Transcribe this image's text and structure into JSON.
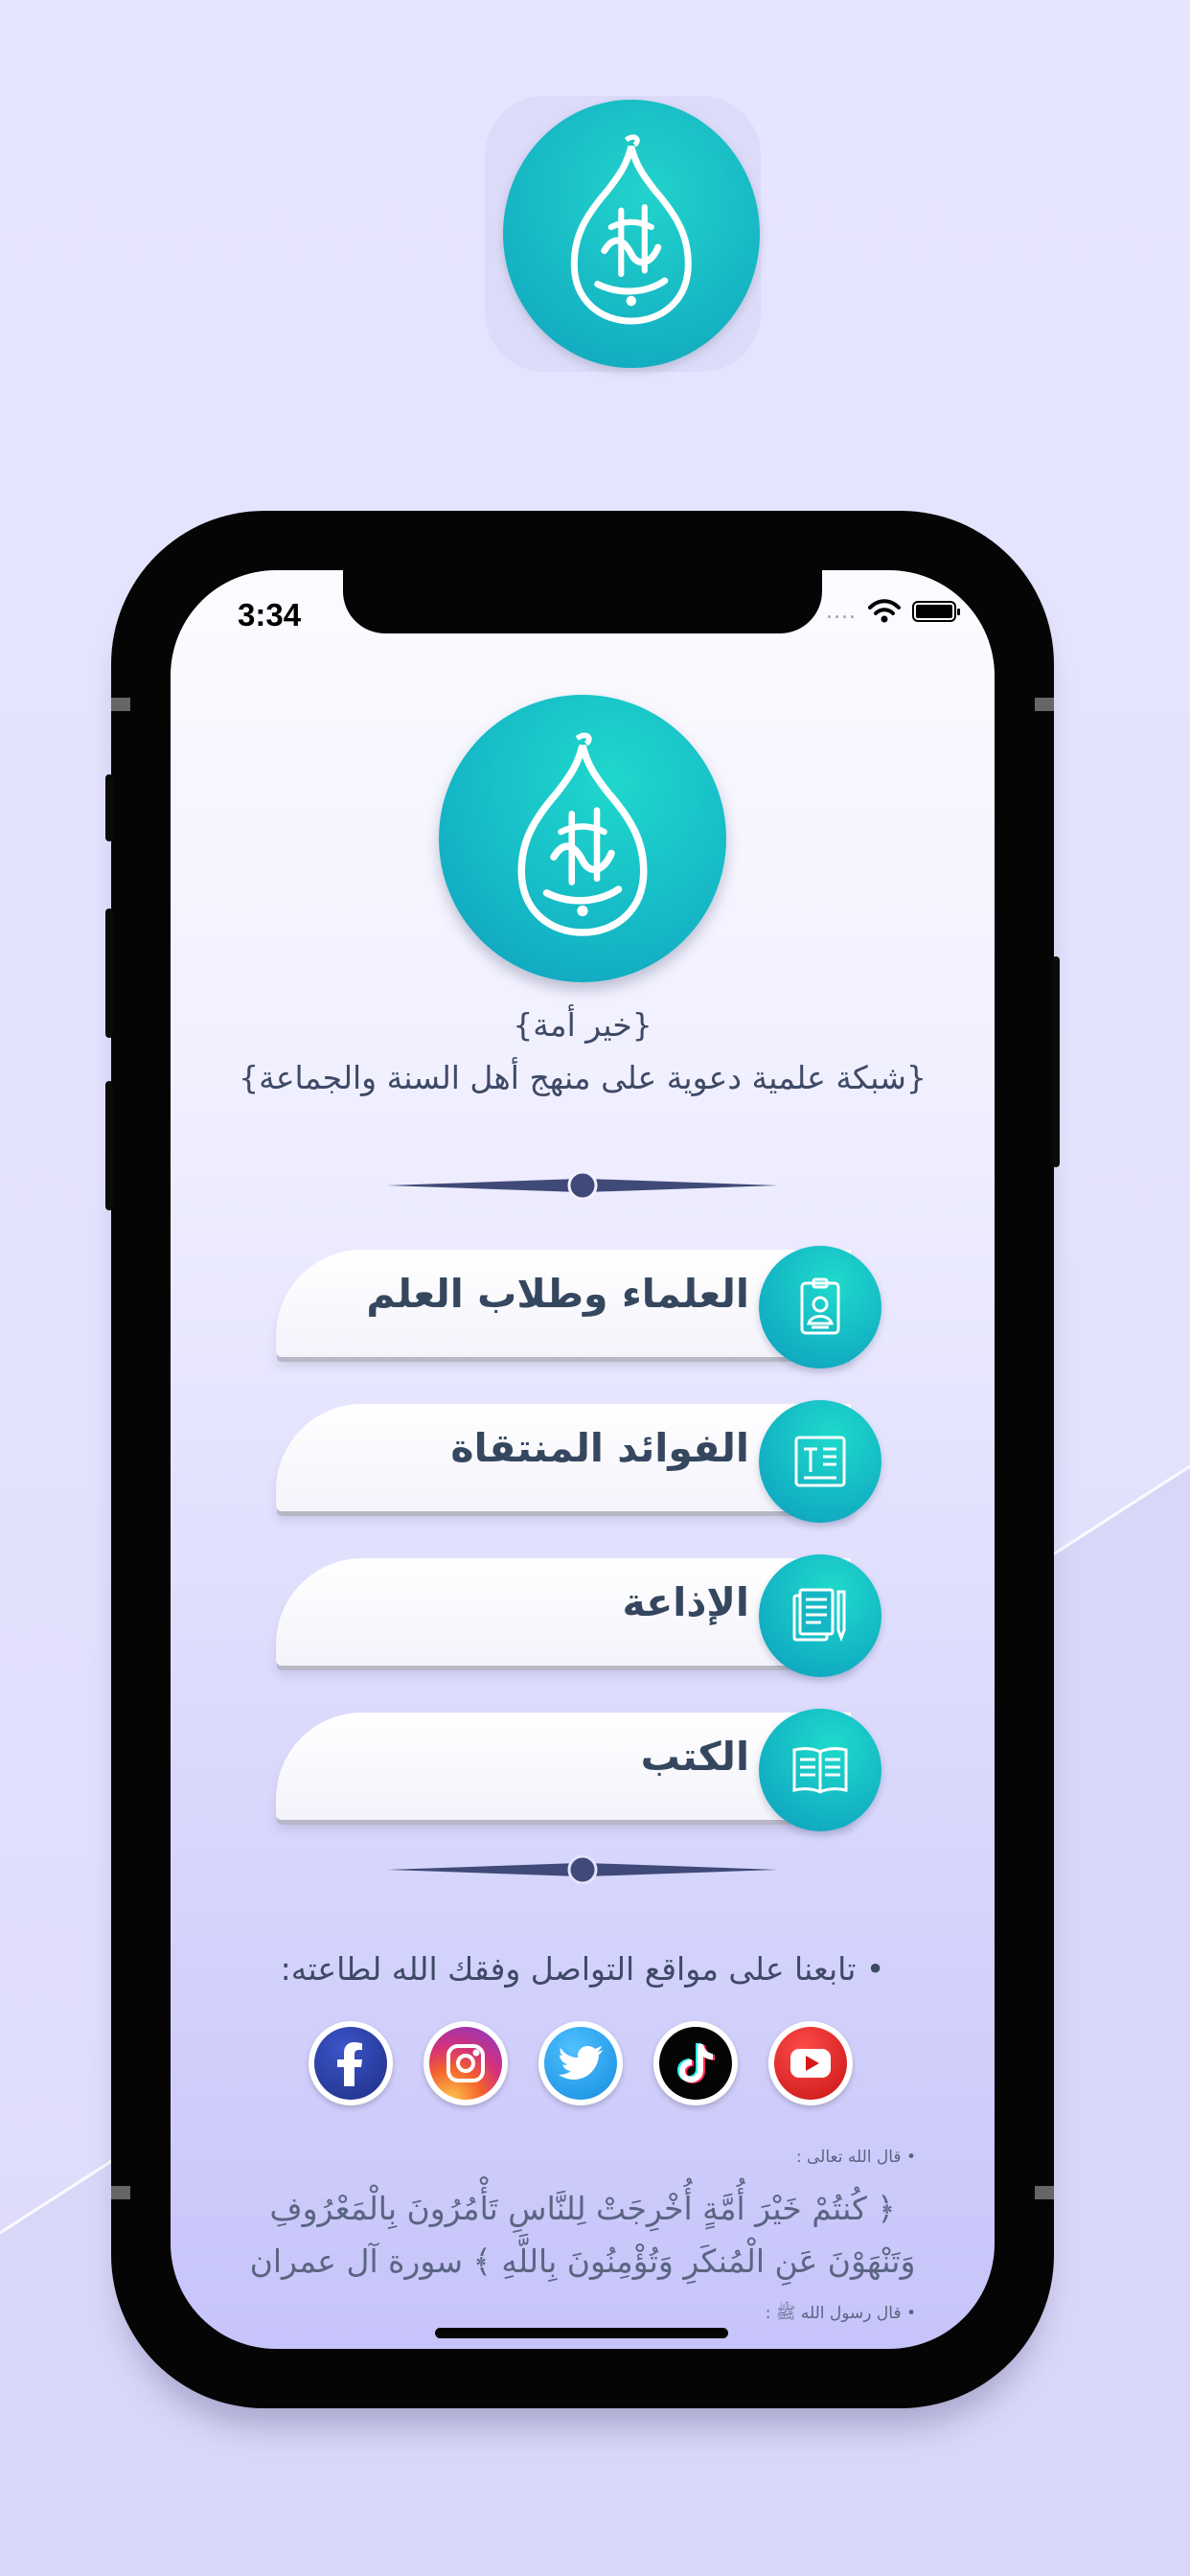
{
  "status_bar": {
    "time": "3:34",
    "signal_dots": "....",
    "wifi_icon": "wifi-icon",
    "battery_icon": "battery-icon"
  },
  "app": {
    "name": "{خير أمة}",
    "tagline": "{شبكة علمية دعوية على منهج أهل السنة والجماعة}"
  },
  "menu": [
    {
      "label": "العلماء وطلاب العلم",
      "icon": "id-badge-icon"
    },
    {
      "label": "الفوائد المنتقاة",
      "icon": "text-document-icon"
    },
    {
      "label": "الإذاعة",
      "icon": "documents-pen-icon"
    },
    {
      "label": "الكتب",
      "icon": "open-book-icon"
    }
  ],
  "follow_text": "• تابعنا على مواقع التواصل وفقك الله لطاعته:",
  "socials": [
    {
      "name": "facebook",
      "icon": "facebook-icon",
      "color": "#2d3fa0"
    },
    {
      "name": "instagram",
      "icon": "instagram-icon",
      "color": "#e1306c"
    },
    {
      "name": "twitter",
      "icon": "twitter-icon",
      "color": "#1da1f2"
    },
    {
      "name": "tiktok",
      "icon": "tiktok-icon",
      "color": "#000000"
    },
    {
      "name": "youtube",
      "icon": "youtube-icon",
      "color": "#e02020"
    }
  ],
  "quotes": {
    "allah_label": "• قال الله تعالى :",
    "verse_line1": "﴿ كُنتُمْ خَيْرَ أُمَّةٍ أُخْرِجَتْ لِلنَّاسِ تَأْمُرُونَ بِالْمَعْرُوفِ",
    "verse_line2": "وَتَنْهَوْنَ عَنِ الْمُنكَرِ وَتُؤْمِنُونَ بِاللَّهِ ﴾ سورة آل عمران",
    "prophet_label": "• قال رسول الله ﷺ :"
  },
  "colors": {
    "accent_teal": "#15b7c6",
    "text_dark": "#35475f",
    "background": "#e4e3fd"
  }
}
